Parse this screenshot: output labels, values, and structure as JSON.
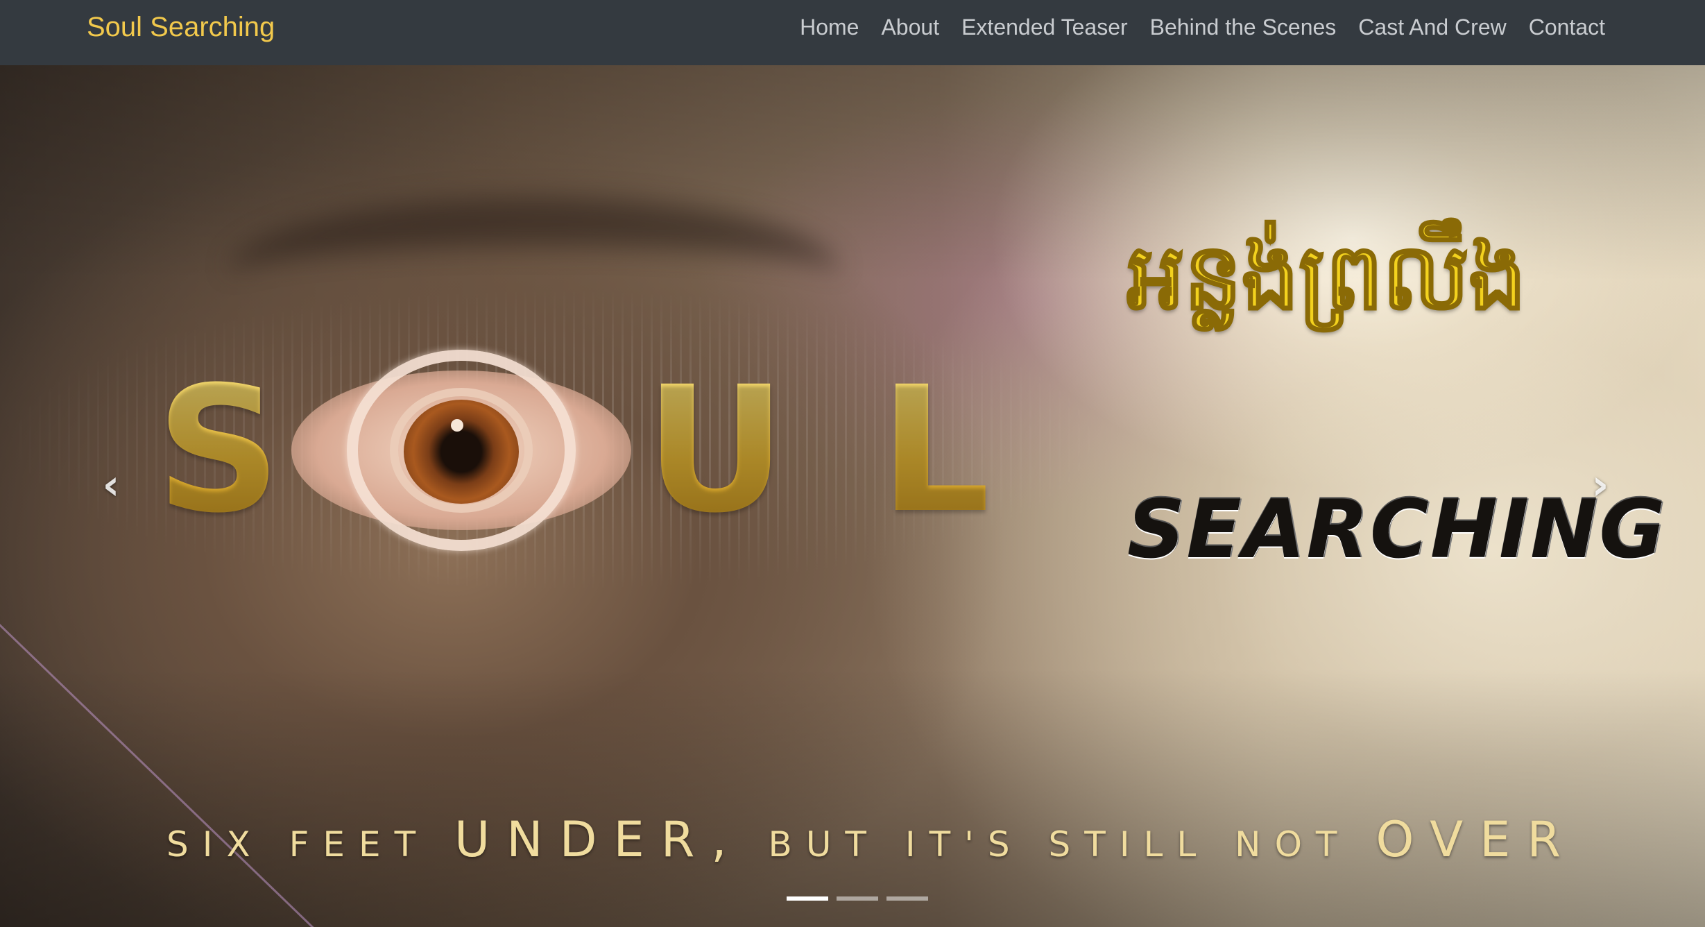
{
  "navbar": {
    "brand": "Soul Searching",
    "links": [
      {
        "label": "Home"
      },
      {
        "label": "About"
      },
      {
        "label": "Extended Teaser"
      },
      {
        "label": "Behind the Scenes"
      },
      {
        "label": "Cast And Crew"
      },
      {
        "label": "Contact"
      }
    ]
  },
  "hero": {
    "khmer_title": "អន្លង់ព្រលឹង",
    "title_letters": [
      "S",
      "U",
      "L"
    ],
    "title_o_icon": "eye-icon",
    "subtitle": "SEARCHING",
    "tagline": {
      "part1": "SIX FEET ",
      "part2": "UNDER,",
      "part3": " BUT IT'S STILL NOT ",
      "part4": "OVER"
    },
    "controls": {
      "prev_icon": "chevron-left-icon",
      "prev_glyph": "‹",
      "next_icon": "chevron-right-icon",
      "next_glyph": "›"
    },
    "indicators": {
      "count": 3,
      "active_index": 0
    }
  },
  "colors": {
    "navbar_bg": "#343a40",
    "brand": "#f2c94c",
    "nav_link": "#c9ccd0",
    "title_gold": "#e5b93a",
    "khmer_yellow": "#f3d21e"
  }
}
